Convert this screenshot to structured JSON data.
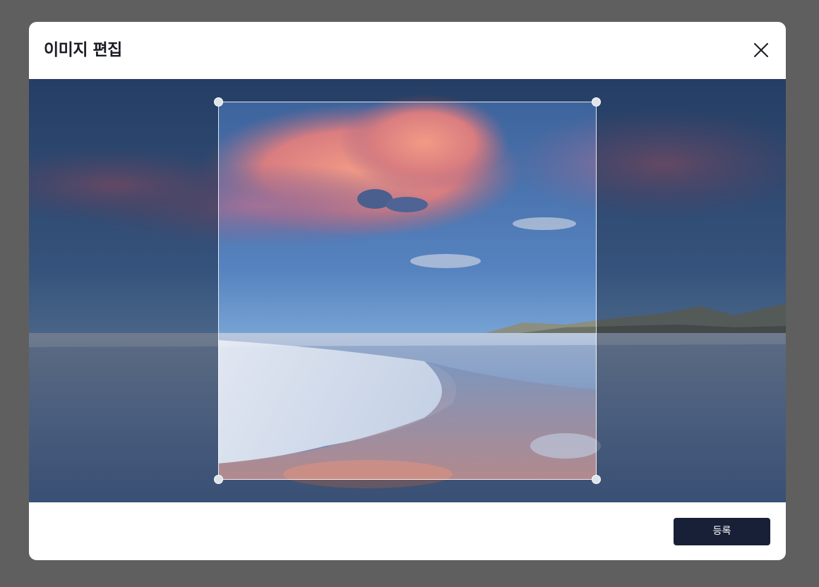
{
  "modal": {
    "title": "이미지 편집",
    "close_icon": "close-icon"
  },
  "editor": {
    "image_subject": "beach-sunset-photo",
    "crop_handle_icons": [
      "crop-handle-top-left-icon",
      "crop-handle-top-right-icon",
      "crop-handle-bottom-left-icon",
      "crop-handle-bottom-right-icon"
    ]
  },
  "footer": {
    "submit_label": "등록"
  },
  "colors": {
    "backdrop": "#5f5f60",
    "modal_bg": "#ffffff",
    "title_text": "#1b1d24",
    "button_bg": "#172036",
    "button_text": "#ffffff"
  }
}
